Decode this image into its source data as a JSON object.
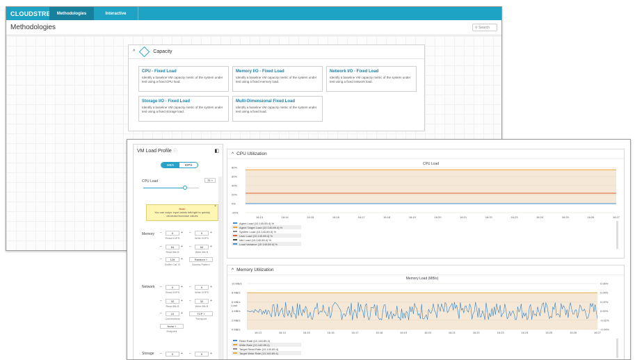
{
  "app": {
    "logo": "CLOUDSTRESS",
    "tabs": [
      "Methodologies",
      "Interactive"
    ],
    "page_title": "Methodologies",
    "search_placeholder": "Search"
  },
  "capacity": {
    "title": "Capacity",
    "cards": [
      {
        "title": "CPU - Fixed Load",
        "desc": "Identify a baseline VM capacity metric of the system under test using a fixed CPU load."
      },
      {
        "title": "Memory I/O - Fixed Load",
        "desc": "Identify a baseline VM capacity metric of the system under test using a fixed memory load."
      },
      {
        "title": "Network I/O - Fixed Load",
        "desc": "Identify a baseline VM capacity metric of the system under test using a fixed network load."
      },
      {
        "title": "Storage I/O - Fixed Load",
        "desc": "Identify a baseline VM capacity metric of the system under test using a fixed storage load."
      },
      {
        "title": "Multi-Dimensional Fixed Load",
        "desc": "Identify a baseline VM capacity metric of the system under test using a fixed load."
      }
    ]
  },
  "vm_profile": {
    "title": "VM Load Profile",
    "seg": [
      "MB/s",
      "IOPS"
    ],
    "cpu_label": "CPU Load",
    "cpu_value": "75",
    "cpu_slider": 0.75,
    "note_title": "Note",
    "note_text": "You can swipe input labels left/right to quickly decrease/increase values",
    "memory_label": "Memory",
    "mem": {
      "read_iops": "0",
      "write_iops": "0",
      "read_iops_lbl": "Read I/OPS",
      "write_iops_lbl": "Write I/OPS",
      "read_blk": "64",
      "write_blk": "64",
      "read_blk_lbl": "Read Blk B",
      "write_blk_lbl": "Write Blk B",
      "buffer": "128",
      "buffer_lbl": "Buffer Cat. B",
      "pattern": "Random",
      "pattern_lbl": "Access Pattern"
    },
    "network_label": "Network",
    "net": {
      "read": "0",
      "write": "0",
      "read_lbl": "Read I/OPS",
      "write_lbl": "Write I/OPS",
      "read_blk": "32",
      "write_blk": "32",
      "read_blk_lbl": "Read Blk B",
      "write_blk_lbl": "Write Blk B",
      "conn": "10",
      "conn_lbl": "Connections",
      "transport": "TCP",
      "transport_lbl": "Transport",
      "endpoint": "None",
      "endpoint_lbl": "Endpoint"
    },
    "storage_label": "Storage",
    "sto": {
      "a": "0",
      "b": "0"
    }
  },
  "cpu_panel": {
    "title": "CPU Utilization",
    "legend": [
      "Agent Load (10.140.89.4) %",
      "Agent Target Load (10.140.89.4) %",
      "System Load (10.140.89.4) %",
      "User Load (10.140.89.4) %",
      "Idle Load (10.140.89.4) %",
      "Load Variance (10.140.89.4) %"
    ],
    "legend_colors": [
      "#3c8dd0",
      "#f0a030",
      "#888888",
      "#e06030",
      "#444444",
      "#3c8dd0"
    ]
  },
  "mem_panel": {
    "title": "Memory Utilization",
    "legend": [
      "Read Rate (10.140.89.4)",
      "Write Rate (10.140.89.4)",
      "Target Read Rate (10.140.89.4)",
      "Target Write Rate (10.140.89.4)"
    ],
    "legend_colors": [
      "#3c8dd0",
      "#f0a030",
      "#888888",
      "#e0b030"
    ]
  },
  "chart_data": [
    {
      "type": "line",
      "title": "CPU Load",
      "x": [
        "16:13",
        "16:14",
        "16:15",
        "16:16",
        "16:17",
        "16:18",
        "16:19",
        "16:20",
        "16:21",
        "16:22",
        "16:23",
        "16:24",
        "16:25",
        "16:26",
        "16:27"
      ],
      "ylim": [
        -20,
        80
      ],
      "yticks": [
        "80%",
        "60%",
        "40%",
        "20%",
        "0%",
        "-20%"
      ],
      "series": [
        {
          "name": "Agent Target Load (10.140.89.4) %",
          "constant": 75
        },
        {
          "name": "User Load (10.140.89.4) %",
          "constant": 23
        },
        {
          "name": "Idle Load (10.140.89.4) %",
          "constant": 0
        }
      ]
    },
    {
      "type": "line",
      "title": "Memory Load (MB/s)",
      "x": [
        "16:13",
        "16:14",
        "16:15",
        "16:16",
        "16:17",
        "16:18",
        "16:19",
        "16:20",
        "16:21",
        "16:22",
        "16:23",
        "16:24",
        "16:25",
        "16:26",
        "16:27"
      ],
      "yticks": [
        "10 MB/s",
        "8 MB/s",
        "6 MB/s",
        "4 MB/s",
        "2 MB/s",
        "0 MB/s"
      ],
      "y2ticks": [
        "0.06%",
        "0.04%",
        "0.02%",
        "0.00%",
        "-0.02%",
        "-0.04%"
      ],
      "ylabel": "Load",
      "y2label": "Variance",
      "ylim": [
        0,
        10
      ],
      "series": [
        {
          "name": "Read Rate (10.140.89.4)",
          "approx_mean": 4,
          "approx_range": [
            2,
            6
          ]
        },
        {
          "name": "Target Read Rate (10.140.89.4)",
          "constant": 8
        }
      ]
    }
  ]
}
